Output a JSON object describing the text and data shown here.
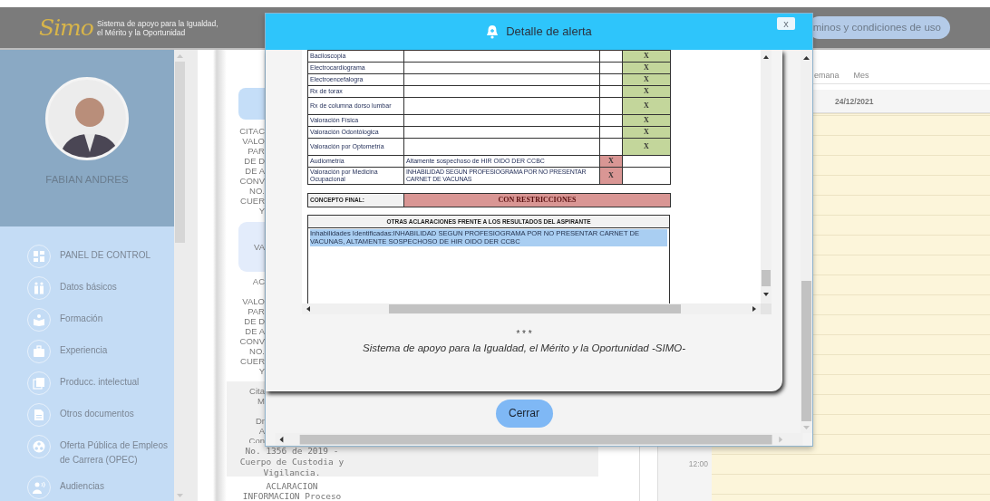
{
  "header": {
    "logo": "Simo",
    "tagline": [
      "Sistema de apoyo para la Igualdad,",
      "el Mérito y la Oportunidad"
    ],
    "terms_link": "minos y condiciones de uso"
  },
  "profile": {
    "name": "FABIAN ANDRES"
  },
  "sidebar": {
    "items": [
      {
        "label": "PANEL DE CONTROL"
      },
      {
        "label": "Datos básicos"
      },
      {
        "label": "Formación"
      },
      {
        "label": "Experiencia"
      },
      {
        "label": "Producc. intelectual"
      },
      {
        "label": "Otros documentos"
      },
      {
        "label": "Oferta Pública de Empleos de Carrera (OPEC)"
      },
      {
        "label": "Audiencias"
      }
    ]
  },
  "document": {
    "block_1": [
      "CITAC",
      "VALO",
      "PAR",
      "DE D",
      "DE A",
      "CONV",
      "NO.",
      "CUER",
      "Y"
    ],
    "card_2": "VA",
    "heading_2": "AC",
    "block_2": [
      "VALO",
      "PAR",
      "DE D",
      "DE A",
      "CONV",
      "NO.",
      "CUER",
      "Y"
    ],
    "panel_3": [
      [
        "Cita",
        "M"
      ],
      [
        "Dr",
        "A",
        "Con"
      ]
    ],
    "panel_3_continued": [
      "No. 1356 de 2019 -",
      "Cuerpo de Custodia y",
      "Vigilancia."
    ],
    "tail": [
      "ACLARACION",
      "INFORMACION Proceso"
    ]
  },
  "calendar": {
    "views": [
      "emana",
      "Mes"
    ],
    "date": "24/12/2021",
    "times": [
      "12:00"
    ]
  },
  "modal": {
    "title": "Detalle de alerta",
    "close": "x",
    "results": [
      {
        "label": "Baciloscopia",
        "column_4": "X",
        "color": "#c3d69b"
      },
      {
        "label": "Electrocardiograma",
        "column_4": "X",
        "color": "#c3d69b"
      },
      {
        "label": "Electroencefalogra",
        "column_4": "X",
        "color": "#c3d69b"
      },
      {
        "label": "Rx de torax",
        "column_4": "X",
        "color": "#c3d69b"
      },
      {
        "label": "Rx de columna dorso lumbar",
        "column_4": "X",
        "color": "#c3d69b"
      },
      {
        "label": "Valoración Física",
        "column_4": "X",
        "color": "#c3d69b"
      },
      {
        "label": "Valoración Odontólogica",
        "column_4": "X",
        "color": "#c3d69b"
      },
      {
        "label": "Valoración por Optometría",
        "column_4": "X",
        "color": "#c3d69b"
      },
      {
        "label": "Audiometría",
        "finding": "Altamente sospechoso de HIR OIDO DER CCBC",
        "column_3": "X",
        "color": "#d99694"
      },
      {
        "label": "Valoración por Medicina Ocupacional",
        "finding": "INHABILIDAD SEGUN PROFESIOGRAMA POR NO PRESENTAR CARNET DE VACUNAS",
        "column_3": "X",
        "color": "#d99694"
      }
    ],
    "final_concept": {
      "label": "CONCEPTO FINAL:",
      "value": "CON RESTRICCIONES"
    },
    "notes": {
      "heading": "OTRAS ACLARACIONES FRENTE A LOS RESULTADOS DEL ASPIRANTE",
      "text": "Inhabilidades Identificadas:INHABILIDAD SEGUN PROFESIOGRAMA POR NO PRESENTAR CARNET DE VACUNAS, ALTAMENTE SOSPECHOSO DE HIR OIDO DER CCBC",
      "highlighted": true
    },
    "footer": [
      "* * *",
      "Sistema de apoyo para la Igualdad, el Mérito y la Oportunidad -SIMO-"
    ],
    "button": "Cerrar"
  }
}
